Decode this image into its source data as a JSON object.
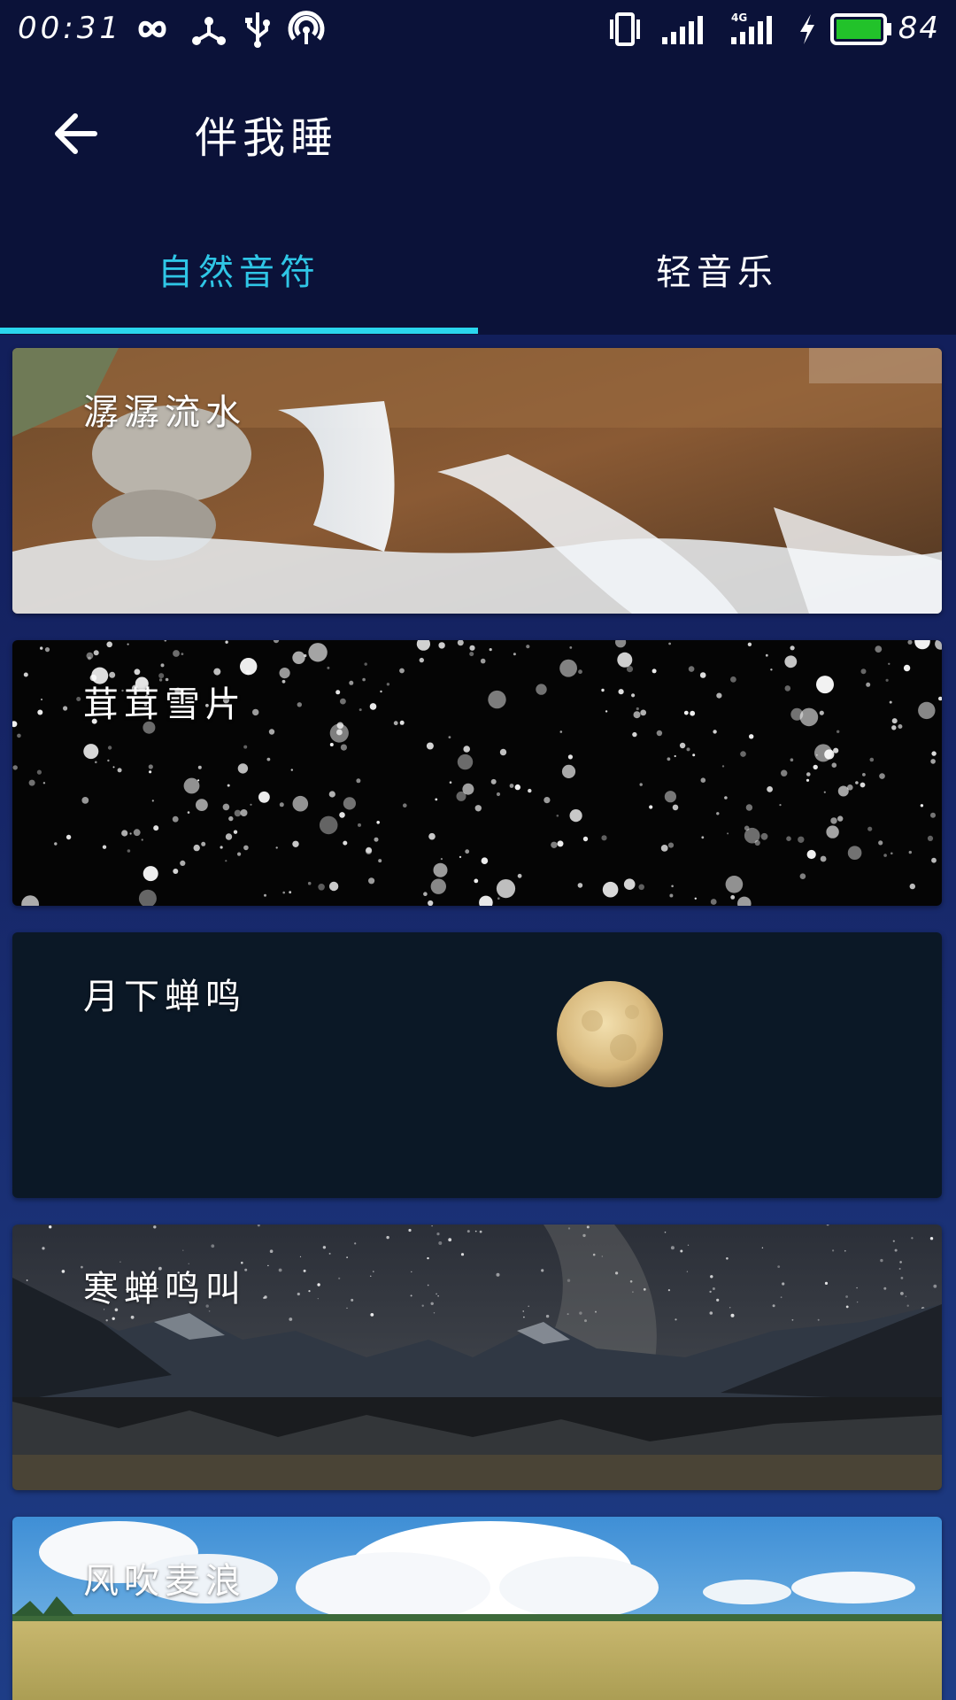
{
  "status_bar": {
    "time": "00:31",
    "battery_level": "84",
    "battery_color": "#22c22a",
    "icons": [
      "infinity-icon",
      "share-hub-icon",
      "usb-icon",
      "hotspot-icon",
      "vibrate-icon",
      "signal-icon",
      "signal-4g-icon",
      "charging-icon",
      "battery-icon"
    ]
  },
  "app_bar": {
    "back_icon": "arrow-left-icon",
    "title": "伴我睡"
  },
  "tabs": [
    {
      "label": "自然音符",
      "active": true
    },
    {
      "label": "轻音乐",
      "active": false
    }
  ],
  "accent_color": "#2ad6ee",
  "cards": [
    {
      "label": "潺潺流水",
      "image": "waterfall-image"
    },
    {
      "label": "茸茸雪片",
      "image": "snowfall-image"
    },
    {
      "label": "月下蝉鸣",
      "image": "moon-image"
    },
    {
      "label": "寒蝉鸣叫",
      "image": "mountain-lake-night-image"
    },
    {
      "label": "风吹麦浪",
      "image": "wheat-field-sky-image"
    }
  ]
}
